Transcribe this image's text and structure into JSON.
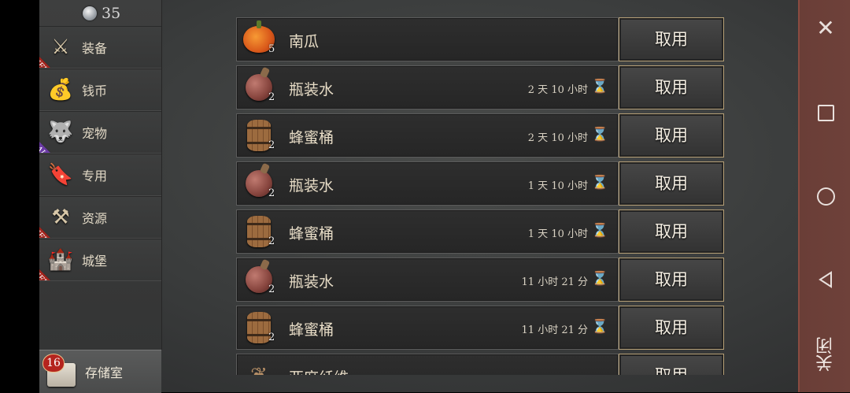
{
  "currency": {
    "gems": "35"
  },
  "sidebar": {
    "items": [
      {
        "label": "装备",
        "icon": "equipment-icon",
        "ribbon": "NEW",
        "ribbon_color": "#a3231c"
      },
      {
        "label": "钱币",
        "icon": "coins-icon",
        "ribbon": "",
        "ribbon_color": ""
      },
      {
        "label": "宠物",
        "icon": "pet-icon",
        "ribbon": "SALE",
        "ribbon_color": "#6b3aa4"
      },
      {
        "label": "专用",
        "icon": "banner-icon",
        "ribbon": "",
        "ribbon_color": ""
      },
      {
        "label": "资源",
        "icon": "resource-tools-icon",
        "ribbon": "NEW",
        "ribbon_color": "#a3231c"
      },
      {
        "label": "城堡",
        "icon": "castle-icon",
        "ribbon": "NEW",
        "ribbon_color": "#a3231c"
      }
    ],
    "storage": {
      "label": "存储室",
      "badge": "16",
      "icon": "storage-box-icon"
    }
  },
  "items": [
    {
      "name": "南瓜",
      "qty": "5",
      "timer": "",
      "icon": "pumpkin-icon",
      "button": "取用"
    },
    {
      "name": "瓶装水",
      "qty": "2",
      "timer": "2 天 10 小时",
      "icon": "water-flask-icon",
      "button": "取用"
    },
    {
      "name": "蜂蜜桶",
      "qty": "2",
      "timer": "2 天 10 小时",
      "icon": "honey-barrel-icon",
      "button": "取用"
    },
    {
      "name": "瓶装水",
      "qty": "2",
      "timer": "1 天 10 小时",
      "icon": "water-flask-icon",
      "button": "取用"
    },
    {
      "name": "蜂蜜桶",
      "qty": "2",
      "timer": "1 天 10 小时",
      "icon": "honey-barrel-icon",
      "button": "取用"
    },
    {
      "name": "瓶装水",
      "qty": "2",
      "timer": "11 小时 21 分",
      "icon": "water-flask-icon",
      "button": "取用"
    },
    {
      "name": "蜂蜜桶",
      "qty": "2",
      "timer": "11 小时 21 分",
      "icon": "honey-barrel-icon",
      "button": "取用"
    },
    {
      "name": "亚麻纤维",
      "qty": "",
      "timer": "",
      "icon": "flax-fiber-icon",
      "button": "取用"
    }
  ],
  "system_bar": {
    "close_label": "关闭",
    "buttons": [
      "close-icon",
      "recents-icon",
      "home-icon",
      "back-icon"
    ]
  }
}
